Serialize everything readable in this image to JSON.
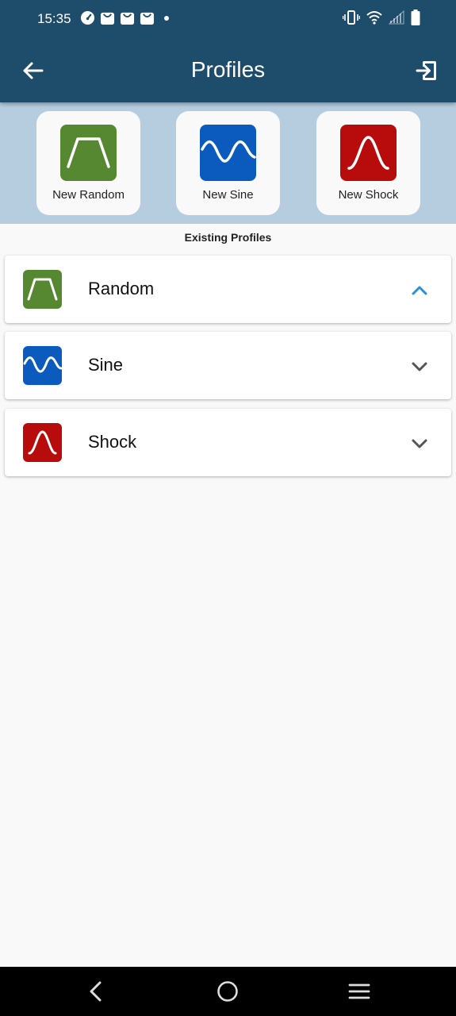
{
  "status_bar": {
    "time": "15:35",
    "left_icons": [
      "speedometer-icon",
      "shopping-bag-icon",
      "shopping-bag-icon",
      "shopping-bag-icon",
      "notification-dot"
    ],
    "right_icons": [
      "vibrate-icon",
      "wifi-icon",
      "cellular-signal-icon",
      "battery-icon"
    ]
  },
  "app_bar": {
    "title": "Profiles",
    "back_icon": "arrow-left-icon",
    "exit_icon": "exit-login-icon"
  },
  "new_profiles": [
    {
      "label": "New Random",
      "icon": "random-profile-icon",
      "color": "#568731"
    },
    {
      "label": "New Sine",
      "icon": "sine-profile-icon",
      "color": "#0b5bbf"
    },
    {
      "label": "New Shock",
      "icon": "shock-profile-icon",
      "color": "#b80c0c"
    }
  ],
  "existing": {
    "title": "Existing Profiles",
    "items": [
      {
        "name": "Random",
        "icon": "random-profile-icon",
        "color": "#568731",
        "expanded": true
      },
      {
        "name": "Sine",
        "icon": "sine-profile-icon",
        "color": "#0b5bbf",
        "expanded": false
      },
      {
        "name": "Shock",
        "icon": "shock-profile-icon",
        "color": "#b80c0c",
        "expanded": false
      }
    ]
  },
  "colors": {
    "header": "#1e4c6b",
    "panel": "#b6cde0",
    "expanded_chevron": "#2a8fd6",
    "collapsed_chevron": "#555555"
  },
  "nav_bar": {
    "icons": [
      "back-triangle-icon",
      "home-circle-icon",
      "menu-lines-icon"
    ]
  }
}
